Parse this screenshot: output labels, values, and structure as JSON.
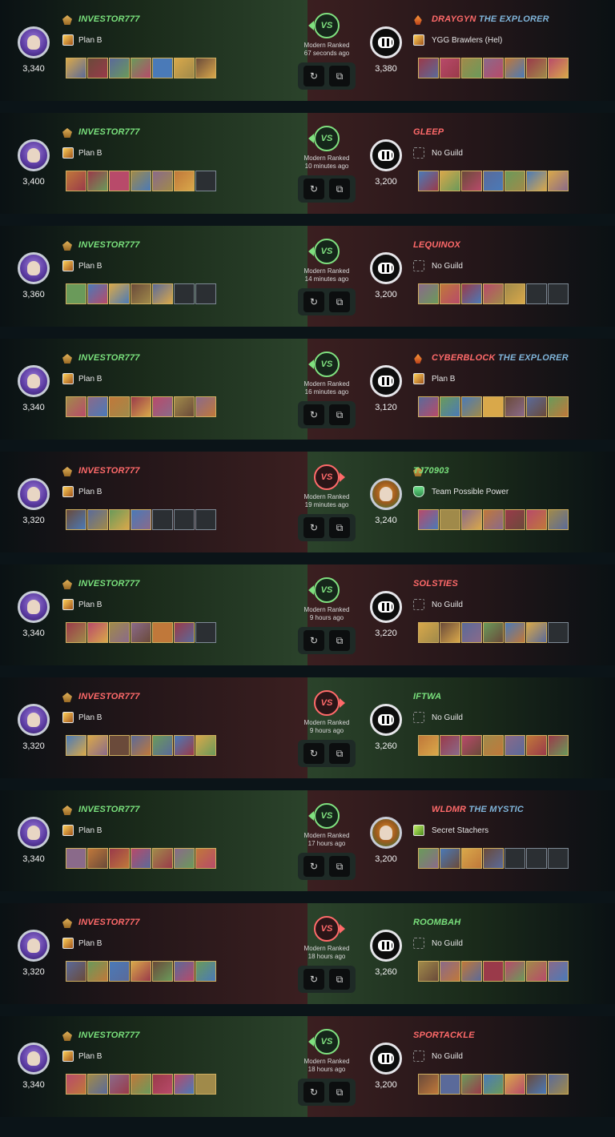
{
  "battles": [
    {
      "result": "win",
      "mode": "Modern Ranked",
      "ago": "67 seconds ago",
      "left": {
        "name": "INVESTOR777",
        "title": "",
        "guild": "Plan B",
        "guild_icon": "std",
        "rating": "3,340",
        "avatar": "purple",
        "cards": 7,
        "rank_icon": "gold"
      },
      "right": {
        "name": "DRAYGYN",
        "title": "THE EXPLORER",
        "guild": "YGG Brawlers (Hel)",
        "guild_icon": "std",
        "rating": "3,380",
        "avatar": "monster",
        "cards": 7,
        "rank_icon": "flame"
      }
    },
    {
      "result": "win",
      "mode": "Modern Ranked",
      "ago": "10 minutes ago",
      "left": {
        "name": "INVESTOR777",
        "title": "",
        "guild": "Plan B",
        "guild_icon": "std",
        "rating": "3,400",
        "avatar": "purple",
        "cards": 6,
        "rank_icon": "gold"
      },
      "right": {
        "name": "GLEEP",
        "title": "",
        "guild": "No Guild",
        "guild_icon": "none",
        "rating": "3,200",
        "avatar": "monster",
        "cards": 7,
        "rank_icon": ""
      }
    },
    {
      "result": "win",
      "mode": "Modern Ranked",
      "ago": "14 minutes ago",
      "left": {
        "name": "INVESTOR777",
        "title": "",
        "guild": "Plan B",
        "guild_icon": "std",
        "rating": "3,360",
        "avatar": "purple",
        "cards": 5,
        "rank_icon": "gold"
      },
      "right": {
        "name": "LEQUINOX",
        "title": "",
        "guild": "No Guild",
        "guild_icon": "none",
        "rating": "3,200",
        "avatar": "monster",
        "cards": 5,
        "rank_icon": ""
      }
    },
    {
      "result": "win",
      "mode": "Modern Ranked",
      "ago": "16 minutes ago",
      "left": {
        "name": "INVESTOR777",
        "title": "",
        "guild": "Plan B",
        "guild_icon": "std",
        "rating": "3,340",
        "avatar": "purple",
        "cards": 7,
        "rank_icon": "gold"
      },
      "right": {
        "name": "CYBERBLOCK",
        "title": "THE EXPLORER",
        "guild": "Plan B",
        "guild_icon": "std",
        "rating": "3,120",
        "avatar": "monster",
        "cards": 7,
        "rank_icon": "flame"
      }
    },
    {
      "result": "loss",
      "mode": "Modern Ranked",
      "ago": "19 minutes ago",
      "left": {
        "name": "INVESTOR777",
        "title": "",
        "guild": "Plan B",
        "guild_icon": "std",
        "rating": "3,320",
        "avatar": "purple",
        "cards": 4,
        "rank_icon": "gold"
      },
      "right": {
        "name": "TJ70903",
        "title": "",
        "guild": "Team Possible Power",
        "guild_icon": "shield",
        "rating": "3,240",
        "avatar": "green",
        "cards": 7,
        "rank_icon": "gold"
      }
    },
    {
      "result": "win",
      "mode": "Modern Ranked",
      "ago": "9 hours ago",
      "left": {
        "name": "INVESTOR777",
        "title": "",
        "guild": "Plan B",
        "guild_icon": "std",
        "rating": "3,340",
        "avatar": "purple",
        "cards": 6,
        "rank_icon": "gold"
      },
      "right": {
        "name": "SOLSTIES",
        "title": "",
        "guild": "No Guild",
        "guild_icon": "none",
        "rating": "3,220",
        "avatar": "monster",
        "cards": 6,
        "rank_icon": ""
      }
    },
    {
      "result": "loss",
      "mode": "Modern Ranked",
      "ago": "9 hours ago",
      "left": {
        "name": "INVESTOR777",
        "title": "",
        "guild": "Plan B",
        "guild_icon": "std",
        "rating": "3,320",
        "avatar": "purple",
        "cards": 7,
        "rank_icon": "gold"
      },
      "right": {
        "name": "IFTWA",
        "title": "",
        "guild": "No Guild",
        "guild_icon": "none",
        "rating": "3,260",
        "avatar": "monster",
        "cards": 7,
        "rank_icon": ""
      }
    },
    {
      "result": "win",
      "mode": "Modern Ranked",
      "ago": "17 hours ago",
      "left": {
        "name": "INVESTOR777",
        "title": "",
        "guild": "Plan B",
        "guild_icon": "std",
        "rating": "3,340",
        "avatar": "purple",
        "cards": 7,
        "rank_icon": "gold"
      },
      "right": {
        "name": "WLDMR",
        "title": "THE MYSTIC",
        "guild": "Secret Stachers",
        "guild_icon": "lime",
        "rating": "3,200",
        "avatar": "green",
        "cards": 4,
        "rank_icon": ""
      }
    },
    {
      "result": "loss",
      "mode": "Modern Ranked",
      "ago": "18 hours ago",
      "left": {
        "name": "INVESTOR777",
        "title": "",
        "guild": "Plan B",
        "guild_icon": "std",
        "rating": "3,320",
        "avatar": "purple",
        "cards": 7,
        "rank_icon": "gold"
      },
      "right": {
        "name": "ROOMBAH",
        "title": "",
        "guild": "No Guild",
        "guild_icon": "none",
        "rating": "3,260",
        "avatar": "monster",
        "cards": 7,
        "rank_icon": ""
      }
    },
    {
      "result": "win",
      "mode": "Modern Ranked",
      "ago": "18 hours ago",
      "left": {
        "name": "INVESTOR777",
        "title": "",
        "guild": "Plan B",
        "guild_icon": "std",
        "rating": "3,340",
        "avatar": "purple",
        "cards": 7,
        "rank_icon": "gold"
      },
      "right": {
        "name": "SPORTACKLE",
        "title": "",
        "guild": "No Guild",
        "guild_icon": "none",
        "rating": "3,200",
        "avatar": "monster",
        "cards": 7,
        "rank_icon": ""
      }
    }
  ],
  "controls": {
    "replay_icon": "replay-icon",
    "copy_icon": "copy-icon"
  },
  "colors": {
    "win": "#79e07c",
    "loss": "#ff6a6a",
    "title": "#7fb4d9"
  }
}
